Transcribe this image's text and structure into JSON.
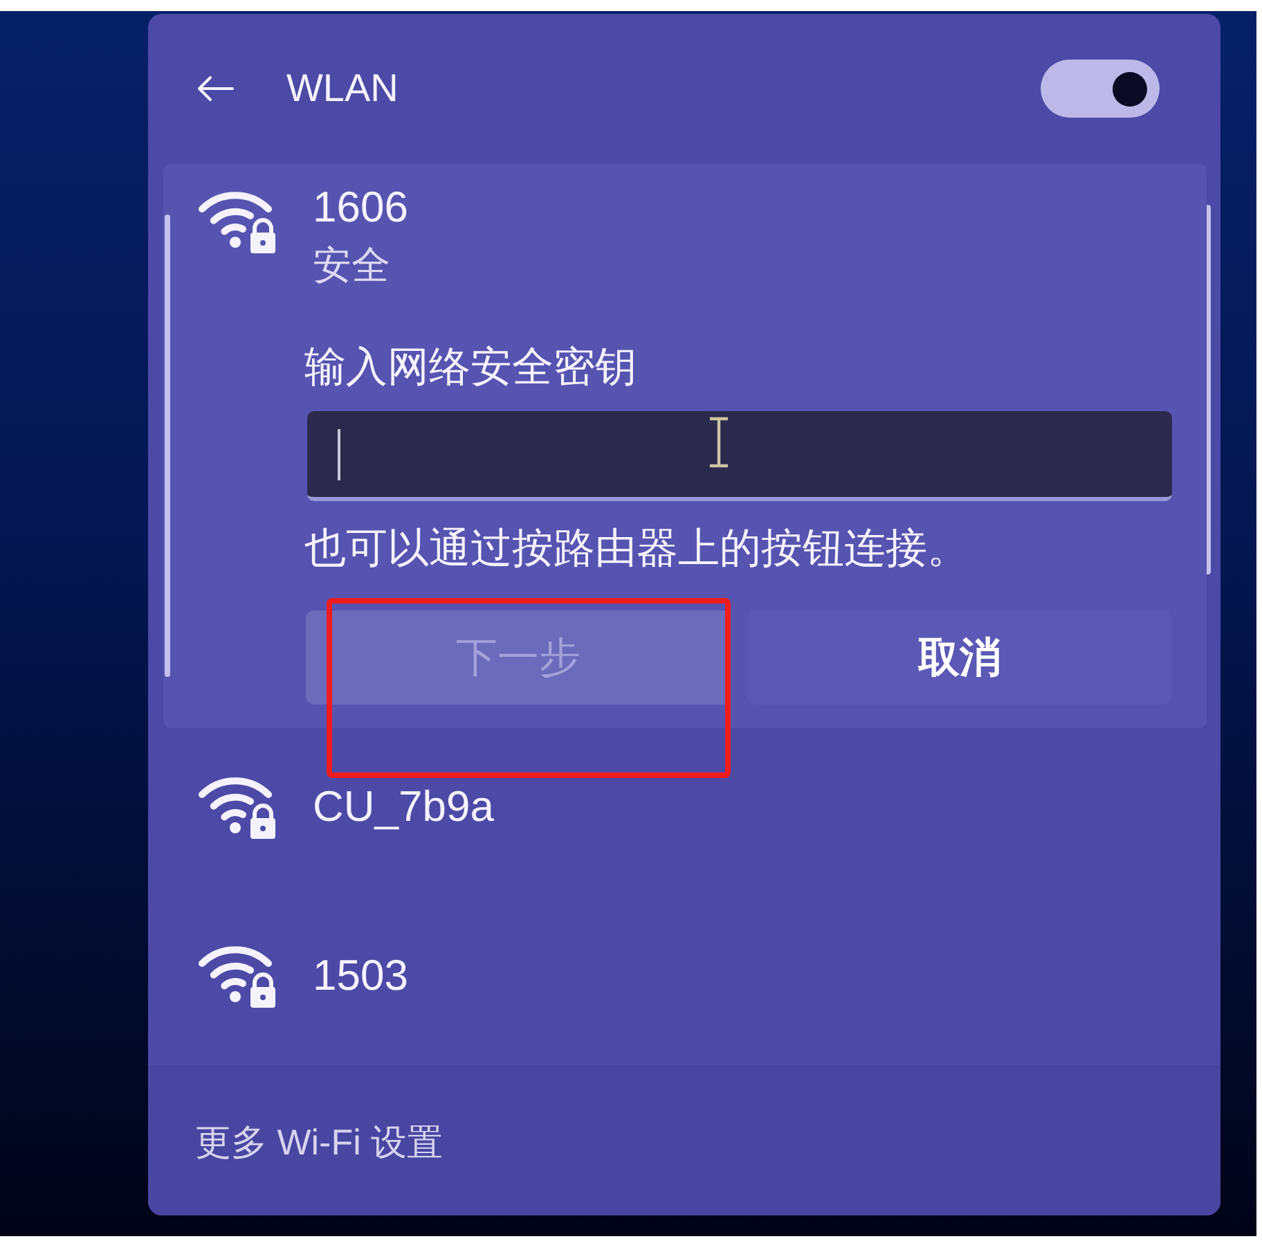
{
  "header": {
    "title": "WLAN",
    "wifi_on": true
  },
  "networks": [
    {
      "name": "1606",
      "status": "安全",
      "secured": true,
      "selected": true,
      "expanded": true,
      "form": {
        "label": "输入网络安全密钥",
        "field_focused": true,
        "hint": "也可以通过按路由器上的按钮连接。",
        "buttons": [
          {
            "label": "下一步",
            "disabled": true,
            "highlighted": true
          },
          {
            "label": "取消",
            "disabled": false,
            "highlighted": false
          }
        ]
      }
    },
    {
      "name": "CU_7b9a",
      "secured": true,
      "selected": false,
      "expanded": false
    },
    {
      "name": "1503",
      "secured": true,
      "selected": false,
      "expanded": false
    }
  ],
  "footer": {
    "link": "更多 Wi-Fi 设置"
  }
}
